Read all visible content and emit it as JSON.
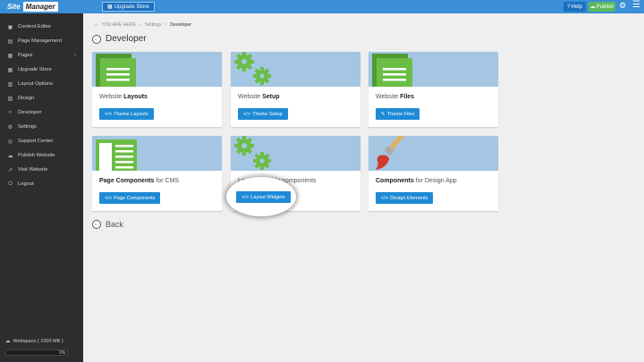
{
  "topbar": {
    "logo_part1": "Site",
    "logo_part2": "Manager",
    "upgrade_label": "Upgrade Store",
    "help_label": "Help",
    "publish_label": "Publish"
  },
  "sidebar": {
    "items": [
      {
        "label": "Content Editor",
        "icon": "▣"
      },
      {
        "label": "Page Management",
        "icon": "▤"
      },
      {
        "label": "Pages",
        "icon": "▦",
        "chevron": "‹"
      },
      {
        "label": "Upgrade Store",
        "icon": "▦"
      },
      {
        "label": "Layout Options",
        "icon": "▥"
      },
      {
        "label": "Design",
        "icon": "▨"
      },
      {
        "label": "Developer",
        "icon": "‹›"
      },
      {
        "label": "Settings",
        "icon": "⚙"
      },
      {
        "label": "Support Center",
        "icon": "◎"
      },
      {
        "label": "Publish Website",
        "icon": "☁"
      },
      {
        "label": "Visit Website",
        "icon": "↗"
      },
      {
        "label": "Logout",
        "icon": "⏻"
      }
    ],
    "webspace_label": "Webspace ( 1000 MB )",
    "webspace_pct": "0%"
  },
  "breadcrumb": {
    "you_are_here": "YOU ARE HERE",
    "sep": "›",
    "settings": "Settings",
    "current": "Developer"
  },
  "page": {
    "title": "Developer",
    "back_label": "Back"
  },
  "cards": [
    {
      "title_pre": "Website ",
      "title_bold": "Layouts",
      "title_post": "",
      "button": "Theme Layouts",
      "btn_icon": "</>"
    },
    {
      "title_pre": "Website ",
      "title_bold": "Setup",
      "title_post": "",
      "button": "Theme Setup",
      "btn_icon": "</>"
    },
    {
      "title_pre": "Website ",
      "title_bold": "Files",
      "title_post": "",
      "button": "Theme Files",
      "btn_icon": "✎"
    },
    {
      "title_pre": "",
      "title_bold": "Page Components",
      "title_post": " for CMS",
      "button": "Page Components",
      "btn_icon": "</>"
    },
    {
      "title_pre": "Layout editable components",
      "title_bold": "",
      "title_post": "",
      "button": "Layout Widgets",
      "btn_icon": "</>"
    },
    {
      "title_pre": "",
      "title_bold": "Components",
      "title_post": " for Design App",
      "button": "Design Elements",
      "btn_icon": "</>"
    }
  ],
  "colors": {
    "topbar": "#3a8fd6",
    "sidebar": "#2d2d2d",
    "button": "#1f8ad6",
    "publish": "#5cb85c",
    "card_image_bg": "#a4c6e3",
    "icon_green": "#5fae3f"
  }
}
